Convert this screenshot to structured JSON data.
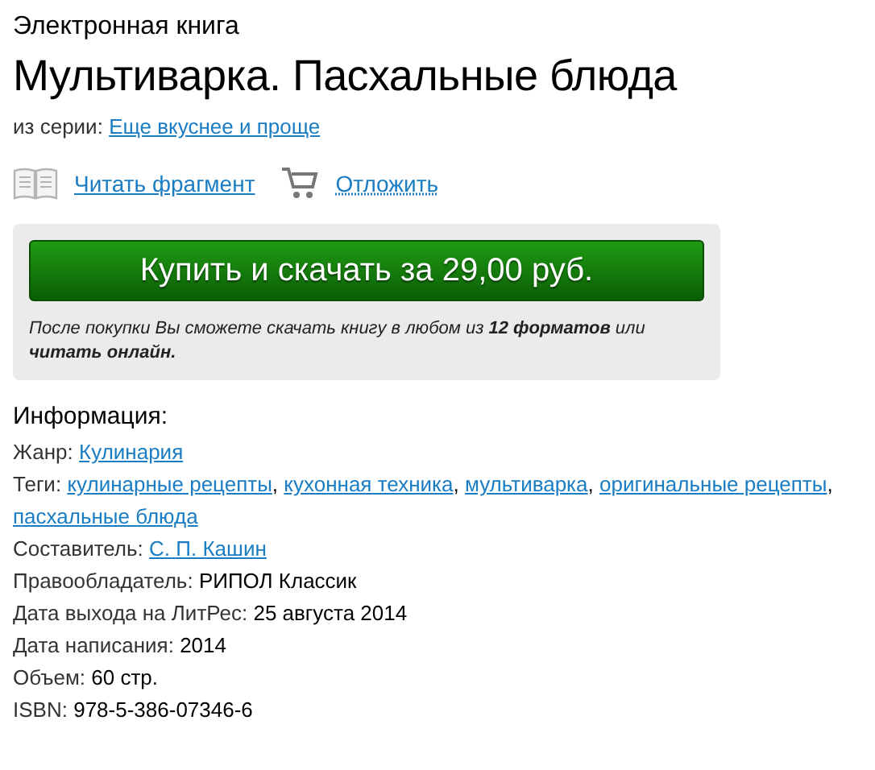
{
  "kind_label": "Электронная книга",
  "title": "Мультиварка. Пасхальные блюда",
  "series": {
    "label": "из серии:",
    "link": "Еще вкуснее и проще"
  },
  "actions": [
    {
      "kind": "read",
      "label": "Читать фрагмент"
    },
    {
      "kind": "cart",
      "label": "Отложить"
    }
  ],
  "buy": {
    "button": "Купить и скачать за 29,00 руб.",
    "note": "После покупки Вы сможете скачать книгу в любом из **12 форматов** или **читать онлайн.**"
  },
  "info": {
    "heading": "Информация:",
    "rows": [
      {
        "label": "Жанр:",
        "links": [
          {
            "text": "Кулинария"
          }
        ]
      },
      {
        "label": "Теги:",
        "links": [
          {
            "text": "кулинарные рецепты",
            "separator": ","
          },
          {
            "text": "кухонная техника",
            "separator": ","
          },
          {
            "text": "мультиварка",
            "separator": ","
          },
          {
            "text": "оригинальные рецепты",
            "separator": ","
          },
          {
            "text": "пасхальные блюда"
          }
        ]
      },
      {
        "label": "Составитель:",
        "links": [
          {
            "text": "С. П. Кашин"
          }
        ]
      },
      {
        "label": "Правообладатель:",
        "value": "РИПОЛ Классик"
      },
      {
        "label": "Дата выхода на ЛитРес:",
        "value": "25 августа 2014"
      },
      {
        "label": "Дата написания:",
        "value": "2014"
      },
      {
        "label": "Объем:",
        "value": "60 стр."
      },
      {
        "label": "ISBN:",
        "value": "978-5-386-07346-6"
      }
    ]
  }
}
